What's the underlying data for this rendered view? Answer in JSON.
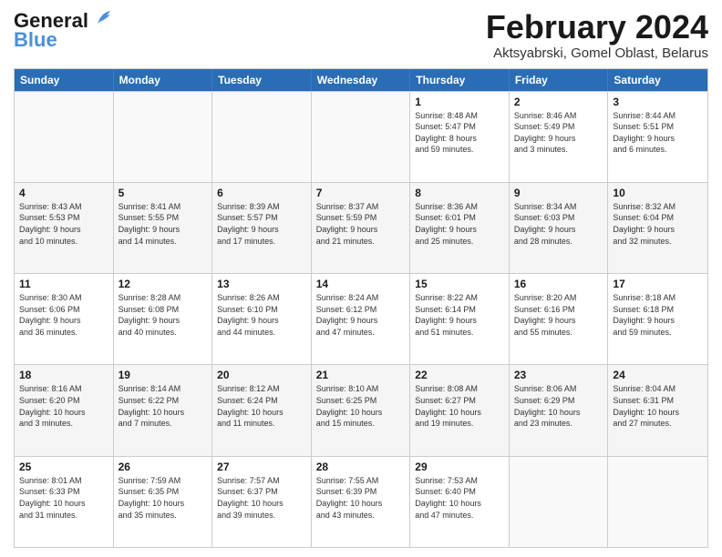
{
  "header": {
    "logo_line1": "General",
    "logo_line2": "Blue",
    "main_title": "February 2024",
    "subtitle": "Aktsyabrski, Gomel Oblast, Belarus"
  },
  "weekdays": [
    "Sunday",
    "Monday",
    "Tuesday",
    "Wednesday",
    "Thursday",
    "Friday",
    "Saturday"
  ],
  "weeks": [
    [
      {
        "day": "",
        "info": ""
      },
      {
        "day": "",
        "info": ""
      },
      {
        "day": "",
        "info": ""
      },
      {
        "day": "",
        "info": ""
      },
      {
        "day": "1",
        "info": "Sunrise: 8:48 AM\nSunset: 5:47 PM\nDaylight: 8 hours\nand 59 minutes."
      },
      {
        "day": "2",
        "info": "Sunrise: 8:46 AM\nSunset: 5:49 PM\nDaylight: 9 hours\nand 3 minutes."
      },
      {
        "day": "3",
        "info": "Sunrise: 8:44 AM\nSunset: 5:51 PM\nDaylight: 9 hours\nand 6 minutes."
      }
    ],
    [
      {
        "day": "4",
        "info": "Sunrise: 8:43 AM\nSunset: 5:53 PM\nDaylight: 9 hours\nand 10 minutes."
      },
      {
        "day": "5",
        "info": "Sunrise: 8:41 AM\nSunset: 5:55 PM\nDaylight: 9 hours\nand 14 minutes."
      },
      {
        "day": "6",
        "info": "Sunrise: 8:39 AM\nSunset: 5:57 PM\nDaylight: 9 hours\nand 17 minutes."
      },
      {
        "day": "7",
        "info": "Sunrise: 8:37 AM\nSunset: 5:59 PM\nDaylight: 9 hours\nand 21 minutes."
      },
      {
        "day": "8",
        "info": "Sunrise: 8:36 AM\nSunset: 6:01 PM\nDaylight: 9 hours\nand 25 minutes."
      },
      {
        "day": "9",
        "info": "Sunrise: 8:34 AM\nSunset: 6:03 PM\nDaylight: 9 hours\nand 28 minutes."
      },
      {
        "day": "10",
        "info": "Sunrise: 8:32 AM\nSunset: 6:04 PM\nDaylight: 9 hours\nand 32 minutes."
      }
    ],
    [
      {
        "day": "11",
        "info": "Sunrise: 8:30 AM\nSunset: 6:06 PM\nDaylight: 9 hours\nand 36 minutes."
      },
      {
        "day": "12",
        "info": "Sunrise: 8:28 AM\nSunset: 6:08 PM\nDaylight: 9 hours\nand 40 minutes."
      },
      {
        "day": "13",
        "info": "Sunrise: 8:26 AM\nSunset: 6:10 PM\nDaylight: 9 hours\nand 44 minutes."
      },
      {
        "day": "14",
        "info": "Sunrise: 8:24 AM\nSunset: 6:12 PM\nDaylight: 9 hours\nand 47 minutes."
      },
      {
        "day": "15",
        "info": "Sunrise: 8:22 AM\nSunset: 6:14 PM\nDaylight: 9 hours\nand 51 minutes."
      },
      {
        "day": "16",
        "info": "Sunrise: 8:20 AM\nSunset: 6:16 PM\nDaylight: 9 hours\nand 55 minutes."
      },
      {
        "day": "17",
        "info": "Sunrise: 8:18 AM\nSunset: 6:18 PM\nDaylight: 9 hours\nand 59 minutes."
      }
    ],
    [
      {
        "day": "18",
        "info": "Sunrise: 8:16 AM\nSunset: 6:20 PM\nDaylight: 10 hours\nand 3 minutes."
      },
      {
        "day": "19",
        "info": "Sunrise: 8:14 AM\nSunset: 6:22 PM\nDaylight: 10 hours\nand 7 minutes."
      },
      {
        "day": "20",
        "info": "Sunrise: 8:12 AM\nSunset: 6:24 PM\nDaylight: 10 hours\nand 11 minutes."
      },
      {
        "day": "21",
        "info": "Sunrise: 8:10 AM\nSunset: 6:25 PM\nDaylight: 10 hours\nand 15 minutes."
      },
      {
        "day": "22",
        "info": "Sunrise: 8:08 AM\nSunset: 6:27 PM\nDaylight: 10 hours\nand 19 minutes."
      },
      {
        "day": "23",
        "info": "Sunrise: 8:06 AM\nSunset: 6:29 PM\nDaylight: 10 hours\nand 23 minutes."
      },
      {
        "day": "24",
        "info": "Sunrise: 8:04 AM\nSunset: 6:31 PM\nDaylight: 10 hours\nand 27 minutes."
      }
    ],
    [
      {
        "day": "25",
        "info": "Sunrise: 8:01 AM\nSunset: 6:33 PM\nDaylight: 10 hours\nand 31 minutes."
      },
      {
        "day": "26",
        "info": "Sunrise: 7:59 AM\nSunset: 6:35 PM\nDaylight: 10 hours\nand 35 minutes."
      },
      {
        "day": "27",
        "info": "Sunrise: 7:57 AM\nSunset: 6:37 PM\nDaylight: 10 hours\nand 39 minutes."
      },
      {
        "day": "28",
        "info": "Sunrise: 7:55 AM\nSunset: 6:39 PM\nDaylight: 10 hours\nand 43 minutes."
      },
      {
        "day": "29",
        "info": "Sunrise: 7:53 AM\nSunset: 6:40 PM\nDaylight: 10 hours\nand 47 minutes."
      },
      {
        "day": "",
        "info": ""
      },
      {
        "day": "",
        "info": ""
      }
    ]
  ]
}
